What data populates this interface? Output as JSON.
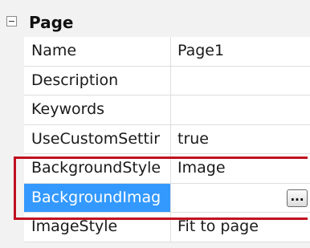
{
  "category": {
    "label": "Page"
  },
  "properties": [
    {
      "name": "Name",
      "value": "Page1"
    },
    {
      "name": "Description",
      "value": ""
    },
    {
      "name": "Keywords",
      "value": ""
    },
    {
      "name": "UseCustomSettir",
      "value": "true"
    },
    {
      "name": "BackgroundStyle",
      "value": "Image"
    },
    {
      "name": "BackgroundImag",
      "value": "",
      "button_label": "..."
    },
    {
      "name": "ImageStyle",
      "value": "Fit to page"
    }
  ],
  "colors": {
    "selection": "#3399ff",
    "highlight_border": "#c0101f",
    "gutter": "#f2f2f2"
  }
}
